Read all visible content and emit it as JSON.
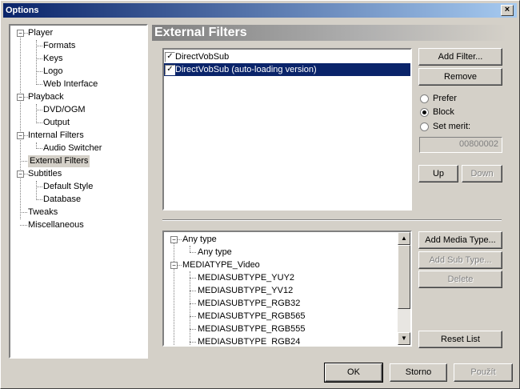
{
  "window": {
    "title": "Options",
    "close_label": "×"
  },
  "tree": {
    "items": [
      {
        "label": "Player",
        "expander": "−"
      },
      {
        "label": "Formats"
      },
      {
        "label": "Keys"
      },
      {
        "label": "Logo"
      },
      {
        "label": "Web Interface"
      },
      {
        "label": "Playback",
        "expander": "−"
      },
      {
        "label": "DVD/OGM"
      },
      {
        "label": "Output"
      },
      {
        "label": "Internal Filters",
        "expander": "−"
      },
      {
        "label": "Audio Switcher"
      },
      {
        "label": "External Filters",
        "selected": true
      },
      {
        "label": "Subtitles",
        "expander": "−"
      },
      {
        "label": "Default Style"
      },
      {
        "label": "Database"
      },
      {
        "label": "Tweaks"
      },
      {
        "label": "Miscellaneous"
      }
    ]
  },
  "page": {
    "title": "External Filters"
  },
  "filters": {
    "items": [
      {
        "label": "DirectVobSub",
        "checked": true,
        "check": "✓"
      },
      {
        "label": "DirectVobSub (auto-loading version)",
        "checked": true,
        "selected": true,
        "check": "✓"
      }
    ],
    "add_label": "Add Filter...",
    "remove_label": "Remove",
    "prefer_label": "Prefer",
    "block_label": "Block",
    "merit_label": "Set merit:",
    "merit_value": "00800002",
    "up_label": "Up",
    "down_label": "Down"
  },
  "types": {
    "items": [
      {
        "label": "Any type",
        "expander": "−"
      },
      {
        "label": "Any type"
      },
      {
        "label": "MEDIATYPE_Video",
        "expander": "−"
      },
      {
        "label": "MEDIASUBTYPE_YUY2"
      },
      {
        "label": "MEDIASUBTYPE_YV12"
      },
      {
        "label": "MEDIASUBTYPE_RGB32"
      },
      {
        "label": "MEDIASUBTYPE_RGB565"
      },
      {
        "label": "MEDIASUBTYPE_RGB555"
      },
      {
        "label": "MEDIASUBTYPE_RGB24"
      }
    ],
    "add_media_label": "Add Media Type...",
    "add_sub_label": "Add Sub Type...",
    "delete_label": "Delete",
    "reset_label": "Reset List",
    "scroll_up": "▲",
    "scroll_down": "▼"
  },
  "footer": {
    "ok_label": "OK",
    "cancel_label": "Storno",
    "apply_label": "Použít"
  }
}
